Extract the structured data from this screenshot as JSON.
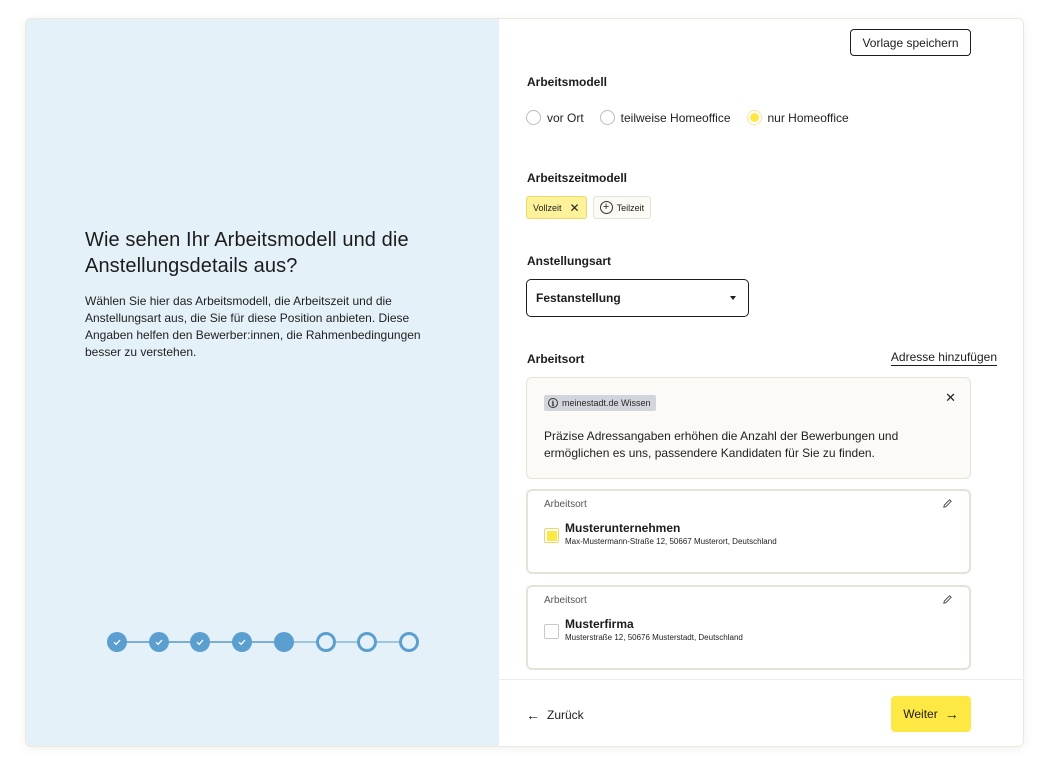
{
  "intro": {
    "title": "Wie sehen Ihr Arbeitsmodell und die Anstellungsdetails aus?",
    "description": "Wählen Sie hier das Arbeitsmodell, die Arbeitszeit und die Anstellungsart aus, die Sie für diese Position anbieten. Diese Angaben helfen den Bewerber:innen, die Rahmenbedingungen besser zu verstehen."
  },
  "stepper": {
    "total": 8,
    "completed": 4,
    "current": 5
  },
  "toolbar": {
    "save_template_label": "Vorlage speichern"
  },
  "work_model": {
    "label": "Arbeitsmodell",
    "options": [
      "vor Ort",
      "teilweise Homeoffice",
      "nur Homeoffice"
    ],
    "selected": "nur Homeoffice"
  },
  "working_time": {
    "label": "Arbeitszeitmodell",
    "selected_chip": "Vollzeit",
    "available_chip": "Teilzeit"
  },
  "employment_type": {
    "label": "Anstellungsart",
    "value": "Festanstellung"
  },
  "location": {
    "label": "Arbeitsort",
    "add_address_label": "Adresse hinzufügen",
    "info": {
      "badge": "meinestadt.de Wissen",
      "text": "Präzise Adressangaben erhöhen die Anzahl der Bewerbungen und ermöglichen es uns, passendere Kandidaten für Sie zu finden."
    },
    "addresses": [
      {
        "card_label": "Arbeitsort",
        "name": "Musterunternehmen",
        "street": "Max-Mustermann-Straße 12, 50667 Musterort, Deutschland",
        "checked": true
      },
      {
        "card_label": "Arbeitsort",
        "name": "Musterfirma",
        "street": "Musterstraße 12, 50676 Musterstadt, Deutschland",
        "checked": false
      }
    ]
  },
  "footer": {
    "back_label": "Zurück",
    "next_label": "Weiter"
  },
  "colors": {
    "accent_yellow": "#fde844",
    "step_blue": "#5b9fd0",
    "left_panel_bg": "#e5f1f9"
  },
  "icons": {
    "check": "check-icon",
    "close": "close-icon",
    "plus": "plus-circle-icon",
    "info": "info-icon",
    "pencil": "pencil-icon",
    "arrow_left": "arrow-left-icon",
    "arrow_right": "arrow-right-icon",
    "caret": "caret-down-icon"
  }
}
